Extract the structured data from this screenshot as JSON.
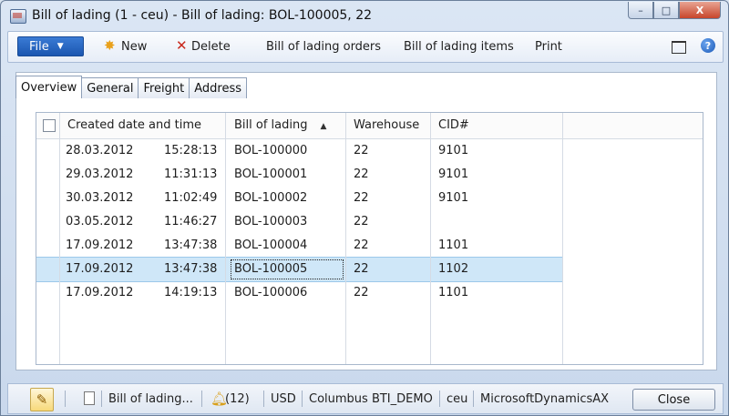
{
  "window": {
    "title": "Bill of lading (1 - ceu) - Bill of lading: BOL-100005, 22",
    "controls": {
      "minimize": "–",
      "maximize": "□",
      "close": "X"
    }
  },
  "toolbar": {
    "file_label": "File",
    "new_label": "New",
    "delete_label": "Delete",
    "orders_label": "Bill of lading orders",
    "items_label": "Bill of lading items",
    "print_label": "Print",
    "help_label": "?"
  },
  "tabs": [
    {
      "label": "Overview",
      "active": true
    },
    {
      "label": "General",
      "active": false
    },
    {
      "label": "Freight",
      "active": false
    },
    {
      "label": "Address",
      "active": false
    }
  ],
  "grid": {
    "headers": {
      "created": "Created date and time",
      "bol": "Bill of lading",
      "warehouse": "Warehouse",
      "cid": "CID#"
    },
    "sort_indicator": "▲",
    "rows": [
      {
        "date": "28.03.2012",
        "time": "15:28:13",
        "bol": "BOL-100000",
        "warehouse": "22",
        "cid": "9101"
      },
      {
        "date": "29.03.2012",
        "time": "11:31:13",
        "bol": "BOL-100001",
        "warehouse": "22",
        "cid": "9101"
      },
      {
        "date": "30.03.2012",
        "time": "11:02:49",
        "bol": "BOL-100002",
        "warehouse": "22",
        "cid": "9101"
      },
      {
        "date": "03.05.2012",
        "time": "11:46:27",
        "bol": "BOL-100003",
        "warehouse": "22",
        "cid": ""
      },
      {
        "date": "17.09.2012",
        "time": "13:47:38",
        "bol": "BOL-100004",
        "warehouse": "22",
        "cid": "1101"
      },
      {
        "date": "17.09.2012",
        "time": "13:47:38",
        "bol": "BOL-100005",
        "warehouse": "22",
        "cid": "1102"
      },
      {
        "date": "17.09.2012",
        "time": "14:19:13",
        "bol": "BOL-100006",
        "warehouse": "22",
        "cid": "1101"
      }
    ],
    "selected_row": 5
  },
  "statusbar": {
    "form_name": "Bill of lading...",
    "notifications": "(12)",
    "currency": "USD",
    "company": "Columbus BTI_DEMO",
    "partition": "ceu",
    "app": "MicrosoftDynamicsAX",
    "close_label": "Close"
  },
  "colors": {
    "selected_row": "#cfe7f8",
    "file_button": "#1b56b0",
    "window_bg": "#d9e4f1"
  }
}
